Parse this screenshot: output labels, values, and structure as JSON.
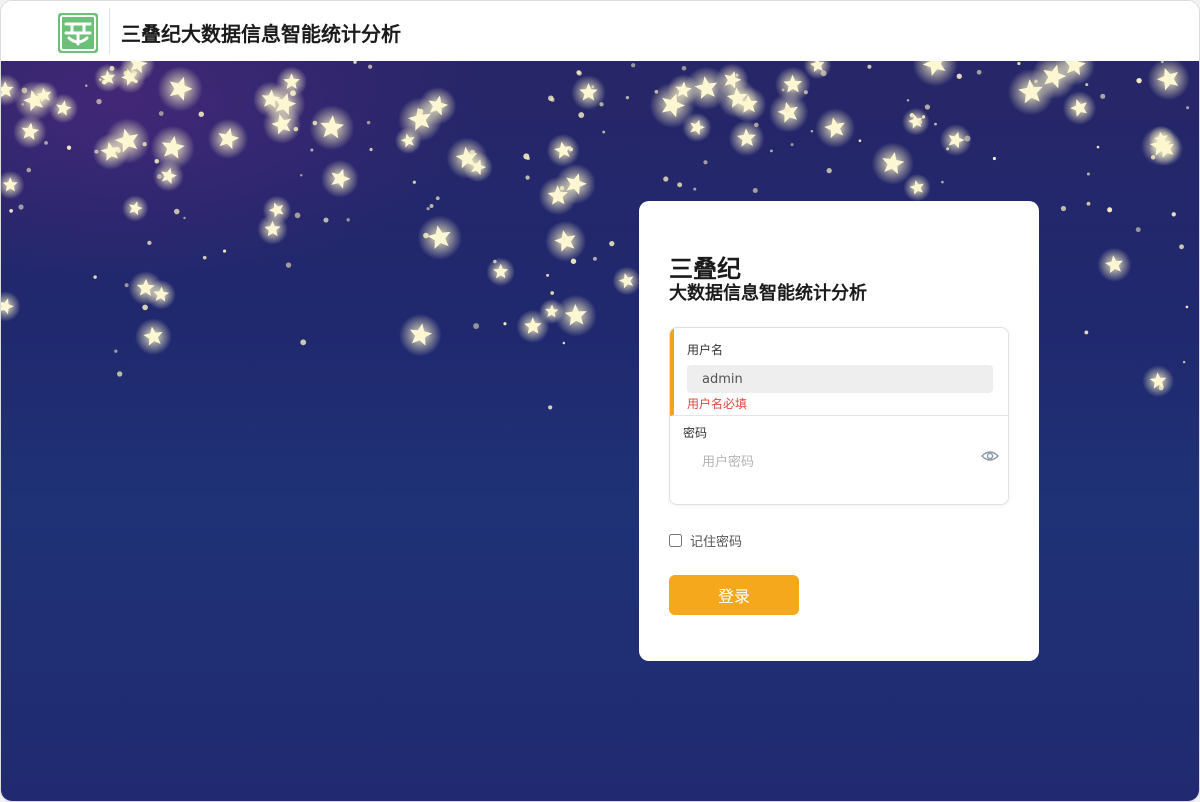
{
  "header": {
    "logo_icon": "sandiejia-logo-icon",
    "app_title": "三叠纪大数据信息智能统计分析"
  },
  "login": {
    "title": "三叠纪",
    "subtitle": "大数据信息智能统计分析",
    "username": {
      "label": "用户名",
      "value": "admin",
      "error": "用户名必填"
    },
    "password": {
      "label": "密码",
      "placeholder": "用户密码",
      "toggle_icon": "eye-icon"
    },
    "remember_label": "记住密码",
    "remember_checked": false,
    "submit_label": "登录"
  },
  "colors": {
    "accent": "#f5a81c",
    "error": "#e0473a",
    "logo_green": "#6dc079",
    "background_top": "#272668",
    "background_bottom": "#212a70"
  }
}
